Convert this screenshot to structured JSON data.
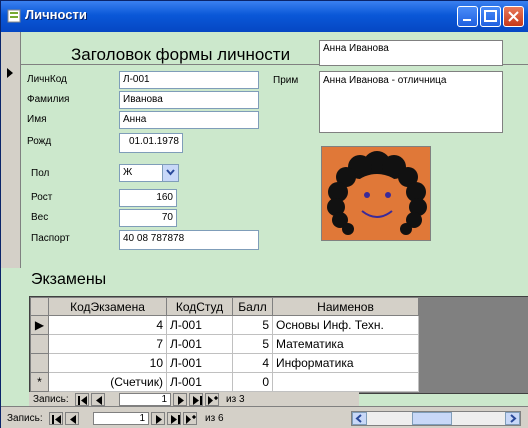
{
  "window": {
    "title": "Личности"
  },
  "form": {
    "heading": "Заголовок формы личности",
    "name_display": "Анна Иванова",
    "labels": {
      "code": "ЛичнКод",
      "surname": "Фамилия",
      "name": "Имя",
      "birth": "Рожд",
      "sex": "Пол",
      "height": "Рост",
      "weight": "Вес",
      "passport": "Паспорт",
      "note": "Прим"
    },
    "values": {
      "code": "Л-001",
      "surname": "Иванова",
      "name": "Анна",
      "birth": "01.01.1978",
      "sex": "Ж",
      "height": "160",
      "weight": "70",
      "passport": "40 08 787878",
      "note": "Анна Иванова - отличница"
    }
  },
  "exams": {
    "title": "Экзамены",
    "columns": [
      "КодЭкзамена",
      "КодСтуд",
      "Балл",
      "Наименов"
    ],
    "rows": [
      {
        "marker": "▶",
        "cells": [
          "4",
          "Л-001",
          "5",
          "Основы Инф. Техн."
        ]
      },
      {
        "marker": "",
        "cells": [
          "7",
          "Л-001",
          "5",
          "Математика"
        ]
      },
      {
        "marker": "",
        "cells": [
          "10",
          "Л-001",
          "4",
          "Информатика"
        ]
      },
      {
        "marker": "*",
        "cells": [
          "(Счетчик)",
          "Л-001",
          "0",
          ""
        ]
      }
    ],
    "nav": {
      "label": "Запись:",
      "record": "1",
      "of": "из  3"
    }
  },
  "main_nav": {
    "label": "Запись:",
    "record": "1",
    "of": "из  6"
  },
  "colors": {
    "form_bg": "#cce8cc",
    "titlebar": "#0a58d8",
    "photo_bg": "#e07838"
  },
  "icons": {
    "first": "first-record-icon",
    "prev": "prev-record-icon",
    "next": "next-record-icon",
    "last": "last-record-icon",
    "new": "new-record-icon"
  }
}
